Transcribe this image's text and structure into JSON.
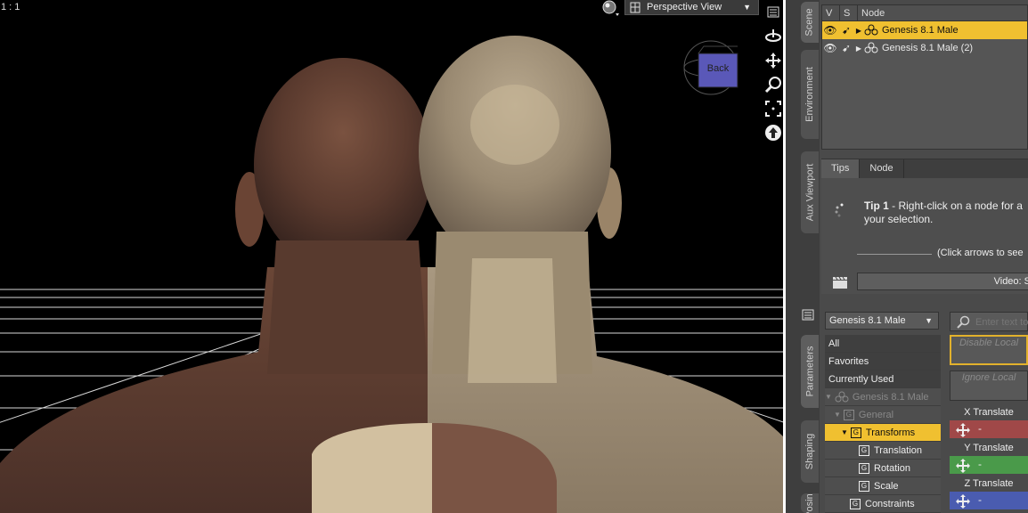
{
  "viewport": {
    "ratio": "1 : 1",
    "view_name": "Perspective View",
    "cube_face": "Back"
  },
  "side_tabs": {
    "scene": "Scene",
    "environment": "Environment",
    "aux_viewport": "Aux Viewport",
    "parameters": "Parameters",
    "shaping": "Shaping",
    "posing": "Posing"
  },
  "scene": {
    "col_v": "V",
    "col_s": "S",
    "col_node": "Node",
    "nodes": [
      {
        "label": "Genesis 8.1 Male",
        "selected": true
      },
      {
        "label": "Genesis 8.1 Male (2)",
        "selected": false
      }
    ]
  },
  "tips": {
    "tab_tips": "Tips",
    "tab_node": "Node",
    "tip_number": "Tip 1",
    "tip_text": " - Right-click on a node for a your selection.",
    "hint": "(Click arrows to see",
    "video_label": "Video: S"
  },
  "params": {
    "figure_select": "Genesis 8.1 Male",
    "search_placeholder": "Enter text to",
    "tree": [
      {
        "label": "All"
      },
      {
        "label": "Favorites"
      },
      {
        "label": "Currently Used"
      },
      {
        "label": "Genesis 8.1 Male"
      },
      {
        "label": "General"
      },
      {
        "label": "Transforms"
      },
      {
        "label": "Translation"
      },
      {
        "label": "Rotation"
      },
      {
        "label": "Scale"
      },
      {
        "label": "Constraints"
      }
    ],
    "props": {
      "disable_local": "Disable Local",
      "ignore_local": "Ignore Local"
    },
    "sliders": [
      {
        "label": "X Translate",
        "color": "#b04848"
      },
      {
        "label": "Y Translate",
        "color": "#4a9a4a"
      },
      {
        "label": "Z Translate",
        "color": "#4a5cb0"
      }
    ]
  },
  "colors": {
    "selection": "#f0c030",
    "panel": "#4a4a4a",
    "viewport_bg": "#000000"
  }
}
